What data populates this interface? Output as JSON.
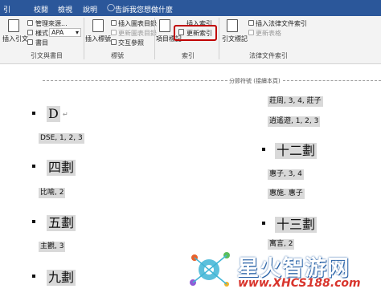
{
  "menu": {
    "tabs": [
      "引",
      "校閱",
      "檢視",
      "說明"
    ],
    "tell_me": "告訴我您想做什麼"
  },
  "ribbon": {
    "insert_citation": "插入引文",
    "manage_sources": "管理來源...",
    "style_label": "樣式:",
    "style_value": "APA",
    "bibliography": "書目",
    "group_citations": "引文與書目",
    "insert_caption": "插入標號",
    "insert_table_of_figures": "插入圖表目錄",
    "update_table": "更新圖表目錄",
    "cross_reference": "交互參照",
    "group_captions": "標號",
    "mark_entry": "項目標記",
    "insert_index": "插入索引",
    "update_index": "更新索引",
    "group_index": "索引",
    "mark_citation": "引文標記",
    "insert_table_of_authorities": "插入法律文件索引",
    "update_table_authorities": "更新表格",
    "group_authorities": "法律文件索引"
  },
  "document": {
    "section_break": "分節符號 (接續本頁)",
    "left_column": [
      {
        "heading": "D",
        "entry": "DSE, 1, 2, 3"
      },
      {
        "heading": "四劃",
        "entry": "比喻, 2"
      },
      {
        "heading": "五劃",
        "entry": "主觀, 3"
      },
      {
        "heading": "九劃",
        "entry": ""
      }
    ],
    "right_column": {
      "top_entries": [
        "莊周, 3, 4, 莊子",
        "逍遙遊, 1, 2, 3"
      ],
      "sections": [
        {
          "heading": "十二劃",
          "entries": [
            "惠子, 3, 4",
            "惠施. 惠子"
          ]
        },
        {
          "heading": "十三劃",
          "entries": [
            "寓言, 2"
          ]
        }
      ]
    },
    "para_mark": "↵"
  },
  "watermark": {
    "title": "星火智游网",
    "url": "www.XHCS188.com"
  },
  "colors": {
    "title_bar": "#2b579a",
    "highlight_box": "#c00000",
    "field_shading": "#d9d9d9"
  }
}
